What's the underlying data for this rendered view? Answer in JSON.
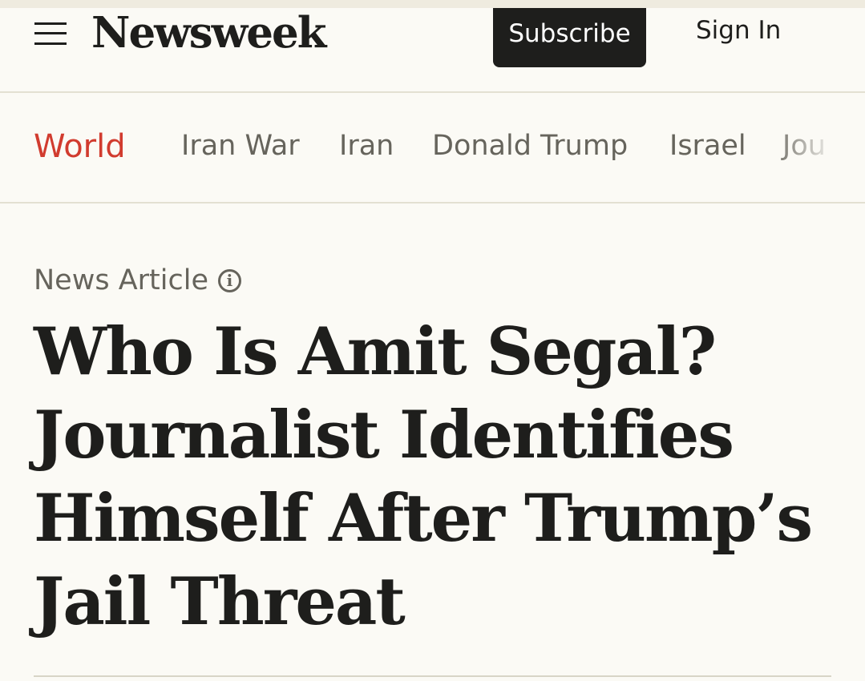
{
  "header": {
    "logo": "Newsweek",
    "subscribe_label": "Subscribe",
    "signin_label": "Sign In"
  },
  "nav": {
    "section": "World",
    "items": [
      {
        "label": "Iran War"
      },
      {
        "label": "Iran"
      },
      {
        "label": "Donald Trump"
      },
      {
        "label": "Israel"
      },
      {
        "label": "Jou"
      }
    ]
  },
  "article": {
    "type_label": "News Article",
    "info_icon": "i",
    "headline": "Who Is Amit Segal? Journalist Identifies Himself After Trump’s Jail Threat"
  },
  "colors": {
    "background": "#fbfaf5",
    "section_accent": "#d13b2e",
    "text_dark": "#1e1e1c",
    "text_muted": "#66645c"
  }
}
